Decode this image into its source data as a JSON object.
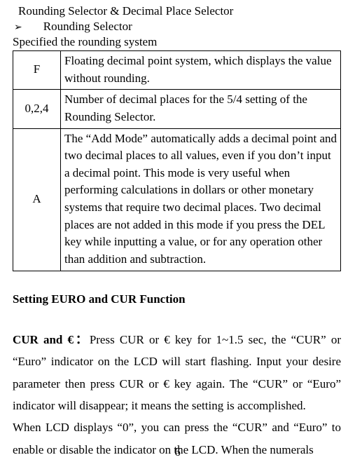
{
  "header": {
    "line1": "Rounding Selector & Decimal Place Selector",
    "bullet_text": "Rounding Selector",
    "line3": "Specified the rounding system"
  },
  "table": {
    "rows": [
      {
        "key": "F",
        "desc": "Floating decimal point system, which displays the value without rounding."
      },
      {
        "key": "0,2,4",
        "desc": "Number of decimal places for the 5/4 setting of the Rounding Selector."
      },
      {
        "key": "A",
        "desc": "The “Add Mode” automatically adds a decimal point and two decimal places to all values, even if you don’t input a decimal point. This mode is very useful when performing calculations in dollars or other monetary systems that require two decimal places. Two decimal places are not added in this mode if you press the DEL key while inputting a value, or for any operation other than addition and subtraction."
      }
    ]
  },
  "section_heading": "Setting EURO and CUR Function",
  "para1": {
    "bold": "CUR and €：",
    "rest": "Press CUR or € key for 1~1.5 sec, the “CUR” or “Euro” indicator on the LCD will start flashing. Input your desire parameter then press CUR or € key again. The “CUR” or “Euro” indicator will disappear; it means the setting is accomplished."
  },
  "para2": "When LCD displays “0”, you can press the “CUR” and “Euro” to enable or disable the indicator on the LCD. When the numerals",
  "page_number": "6"
}
